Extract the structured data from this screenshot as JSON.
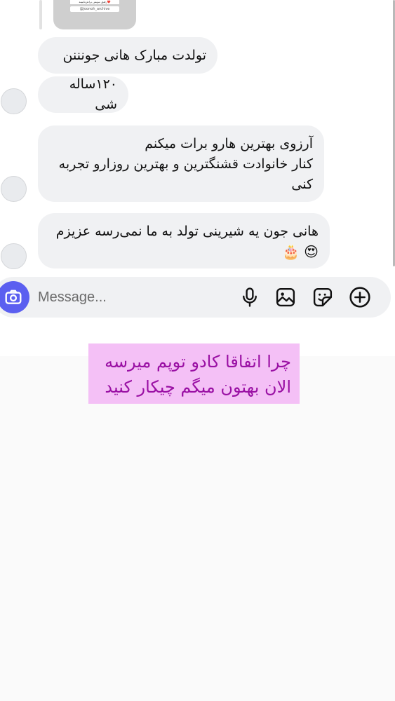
{
  "shared_post": {
    "caption": "رفیق بنویس براش‌تا‌ببینه❤️",
    "handle": "@joonoh_archive"
  },
  "messages": [
    {
      "text": "تولدت مبارک هانی جونننن"
    },
    {
      "text": "۱۲۰ساله شی"
    },
    {
      "line1": "آرزوی بهترین هارو برات میکنم",
      "line2": "کنار خانوادت قشنگترین و بهترین روزارو تجربه",
      "line3": "کنی"
    },
    {
      "text": "هانی جون یه شیرینی تولد به ما نمی‌رسه عزیزم",
      "emoji1": "😍",
      "emoji2": "🎂"
    }
  ],
  "composer": {
    "placeholder": "Message...",
    "icons": [
      "camera-icon",
      "microphone-icon",
      "gallery-icon",
      "sticker-icon",
      "add-circle-icon"
    ],
    "accent_color": "#5b5ff0"
  },
  "overlay_note": {
    "line1": "چرا اتفاقا کادو توپم میرسه",
    "line2": "الان بهتون میگم چیکار کنید",
    "bg_color": "#f4c0f6",
    "text_color": "#9a10a4"
  }
}
